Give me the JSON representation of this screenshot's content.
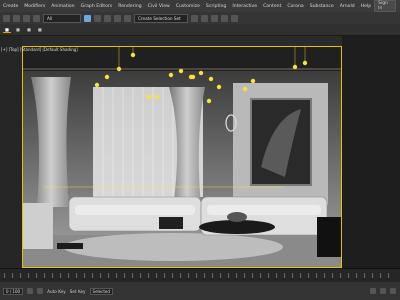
{
  "menubar": {
    "items": [
      "Create",
      "Modifiers",
      "Animation",
      "Graph Editors",
      "Rendering",
      "Civil View",
      "Customize",
      "Scripting",
      "Interactive",
      "Content",
      "Corona",
      "Substance",
      "Arnold",
      "Help"
    ],
    "signin": "Sign In"
  },
  "toolbar": {
    "selection_filter": "All",
    "named_set": "Create Selection Set"
  },
  "viewport": {
    "label": "[+] [Top] [Standard] [Default Shading]"
  },
  "status": {
    "frame": "0 / 100",
    "auto_key": "Auto Key",
    "set_key": "Set Key",
    "selected": "Selected"
  },
  "colors": {
    "viewport_border": "#e5c200",
    "ui_background": "#2b2b2b",
    "light_gizmo": "#ffe033"
  },
  "icons": [
    "play-icon",
    "pause-icon",
    "key-icon",
    "zoom-icon",
    "pan-icon",
    "orbit-icon"
  ]
}
